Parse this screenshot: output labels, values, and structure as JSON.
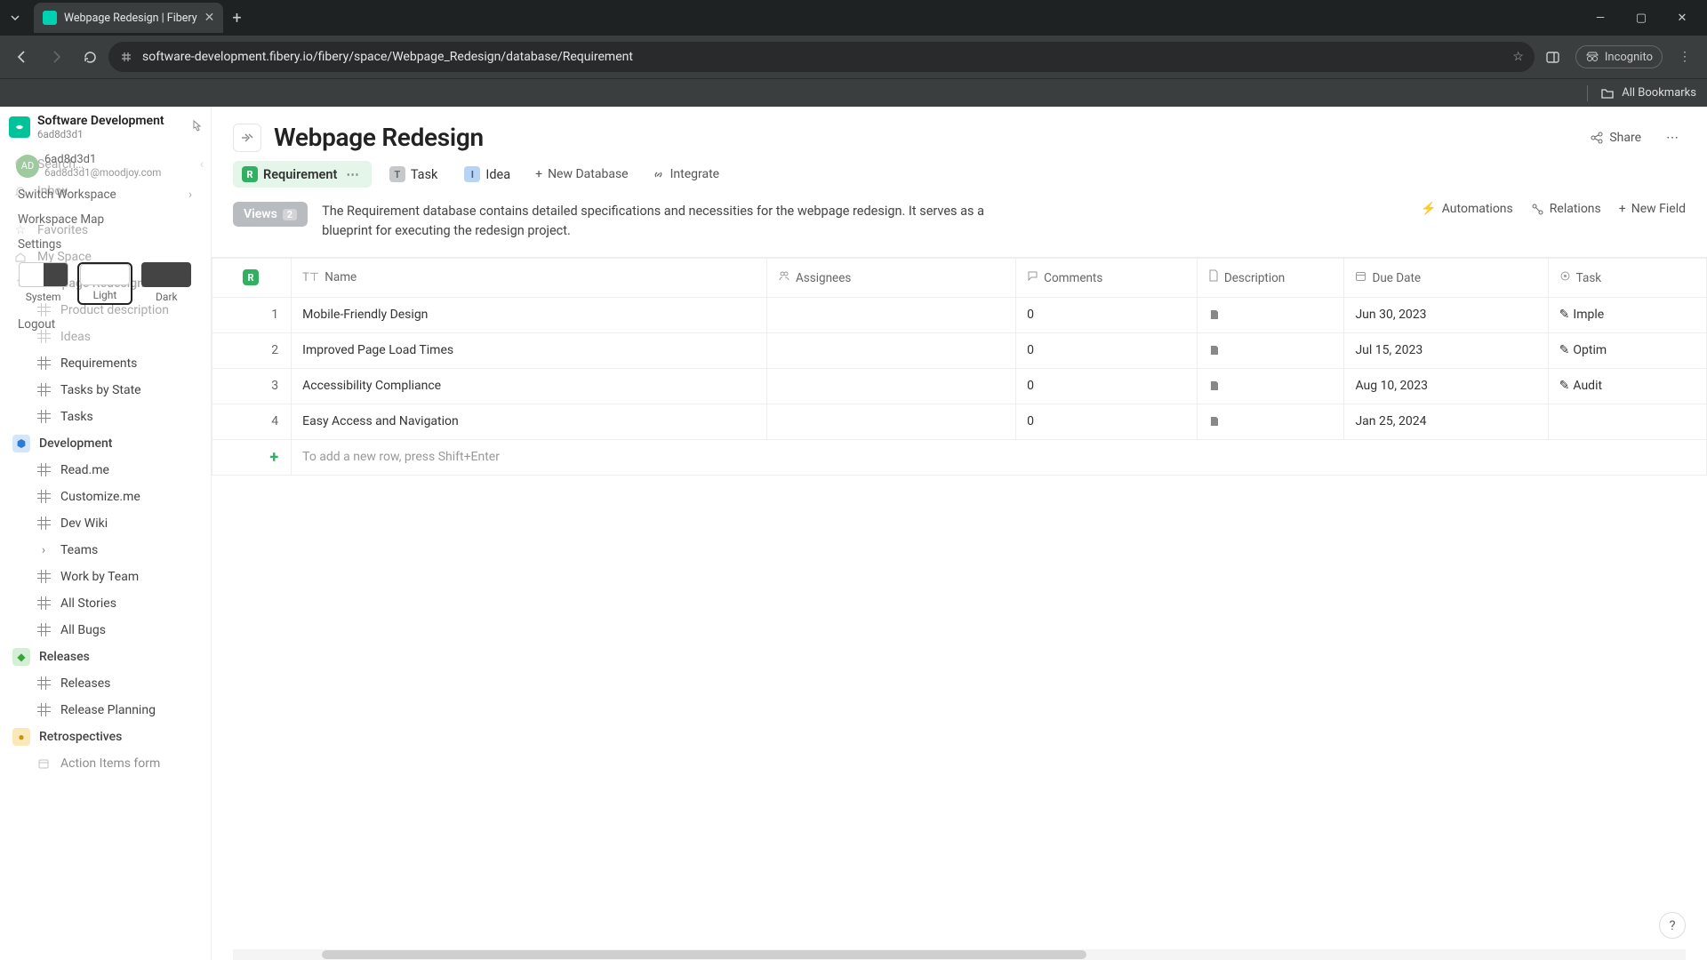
{
  "browser": {
    "tab_title": "Webpage Redesign | Fibery",
    "url": "software-development.fibery.io/fibery/space/Webpage_Redesign/database/Requirement",
    "incognito": "Incognito",
    "all_bookmarks": "All Bookmarks"
  },
  "workspace": {
    "name": "Software Development",
    "id": "6ad8d3d1"
  },
  "popup": {
    "avatar": "AD",
    "username": "6ad8d3d1",
    "email": "6ad8d3d1@moodjoy.com",
    "switch": "Switch Workspace",
    "map": "Workspace Map",
    "settings": "Settings",
    "themes": {
      "system": "System",
      "light": "Light",
      "dark": "Dark"
    },
    "logout": "Logout"
  },
  "sidebar": {
    "search": "Search…",
    "inbox": "Inbox",
    "favorites": "Favorites",
    "myspace": "My Space",
    "spaces": [
      {
        "name": "Webpage Redesign",
        "color": "teal",
        "items": [
          "Product description",
          "Ideas",
          "Requirements",
          "Tasks by State",
          "Tasks"
        ]
      },
      {
        "name": "Development",
        "color": "blue",
        "items": [
          "Read.me",
          "Customize.me",
          "Dev Wiki",
          "Teams",
          "Work by Team",
          "All Stories",
          "All Bugs"
        ]
      },
      {
        "name": "Releases",
        "color": "green",
        "items": [
          "Releases",
          "Release Planning"
        ]
      },
      {
        "name": "Retrospectives",
        "color": "yellow",
        "items": [
          "Action Items form"
        ]
      }
    ]
  },
  "page": {
    "title": "Webpage Redesign",
    "share": "Share",
    "tabs": {
      "requirement": "Requirement",
      "task": "Task",
      "idea": "Idea",
      "new_db": "New Database",
      "integrate": "Integrate"
    },
    "views_label": "Views",
    "views_count": "2",
    "description": "The Requirement database contains detailed specifications and necessities for the webpage redesign. It serves as a blueprint for executing the redesign project.",
    "actions": {
      "automations": "Automations",
      "relations": "Relations",
      "new_field": "New Field"
    }
  },
  "table": {
    "columns": {
      "name": "Name",
      "assignees": "Assignees",
      "comments": "Comments",
      "description": "Description",
      "due": "Due Date",
      "task": "Task"
    },
    "rows": [
      {
        "n": "1",
        "name": "Mobile-Friendly Design",
        "assignees": "",
        "comments": "0",
        "due": "Jun 30, 2023",
        "task": "Imple"
      },
      {
        "n": "2",
        "name": "Improved Page Load Times",
        "assignees": "",
        "comments": "0",
        "due": "Jul 15, 2023",
        "task": "Optim"
      },
      {
        "n": "3",
        "name": "Accessibility Compliance",
        "assignees": "",
        "comments": "0",
        "due": "Aug 10, 2023",
        "task": "Audit"
      },
      {
        "n": "4",
        "name": "Easy Access and Navigation",
        "assignees": "",
        "comments": "0",
        "due": "Jan 25, 2024",
        "task": ""
      }
    ],
    "add_row_hint": "To add a new row, press Shift+Enter"
  }
}
